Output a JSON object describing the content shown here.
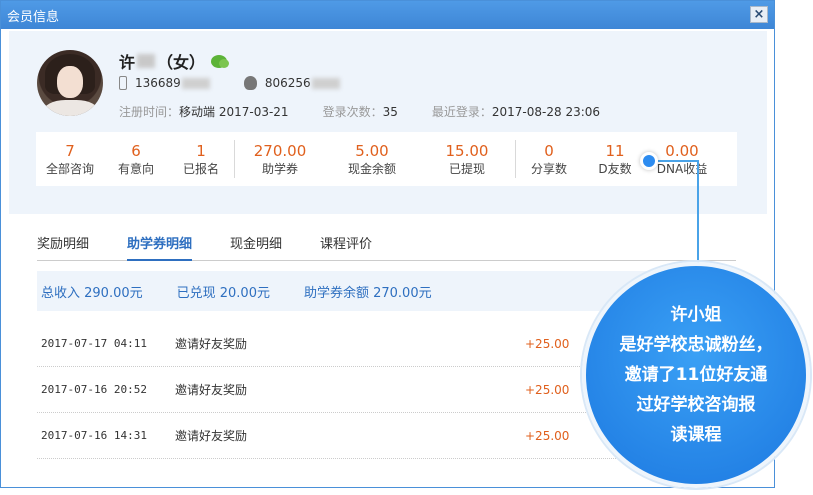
{
  "window": {
    "title": "会员信息",
    "close_label": "×"
  },
  "profile": {
    "name_prefix": "许",
    "name_suffix": "（女）",
    "phone_prefix": "136689",
    "qq_prefix": "806256",
    "register_label": "注册时间：",
    "register_value": "移动端 2017-03-21",
    "login_count_label": "登录次数：",
    "login_count_value": "35",
    "last_login_label": "最近登录：",
    "last_login_value": "2017-08-28 23:06"
  },
  "stats": [
    {
      "num": "7",
      "label": "全部咨询"
    },
    {
      "num": "6",
      "label": "有意向"
    },
    {
      "num": "1",
      "label": "已报名"
    },
    {
      "num": "270.00",
      "label": "助学券"
    },
    {
      "num": "5.00",
      "label": "现金余额"
    },
    {
      "num": "15.00",
      "label": "已提现"
    },
    {
      "num": "0",
      "label": "分享数"
    },
    {
      "num": "11",
      "label": "D友数"
    },
    {
      "num": "0.00",
      "label": "DNA收益"
    }
  ],
  "tabs": [
    {
      "label": "奖励明细"
    },
    {
      "label": "助学券明细"
    },
    {
      "label": "现金明细"
    },
    {
      "label": "课程评价"
    }
  ],
  "summary": {
    "total_income": "总收入 290.00元",
    "redeemed": "已兑现 20.00元",
    "balance": "助学券余额 270.00元"
  },
  "records": [
    {
      "time": "2017-07-17 04:11",
      "desc": "邀请好友奖励",
      "amount": "+25.00"
    },
    {
      "time": "2017-07-16 20:52",
      "desc": "邀请好友奖励",
      "amount": "+25.00"
    },
    {
      "time": "2017-07-16 14:31",
      "desc": "邀请好友奖励",
      "amount": "+25.00"
    }
  ],
  "callout": {
    "lines": [
      "许小姐",
      "是好学校忠诚粉丝，",
      "邀请了11位好友通",
      "过好学校咨询报",
      "读课程"
    ]
  }
}
